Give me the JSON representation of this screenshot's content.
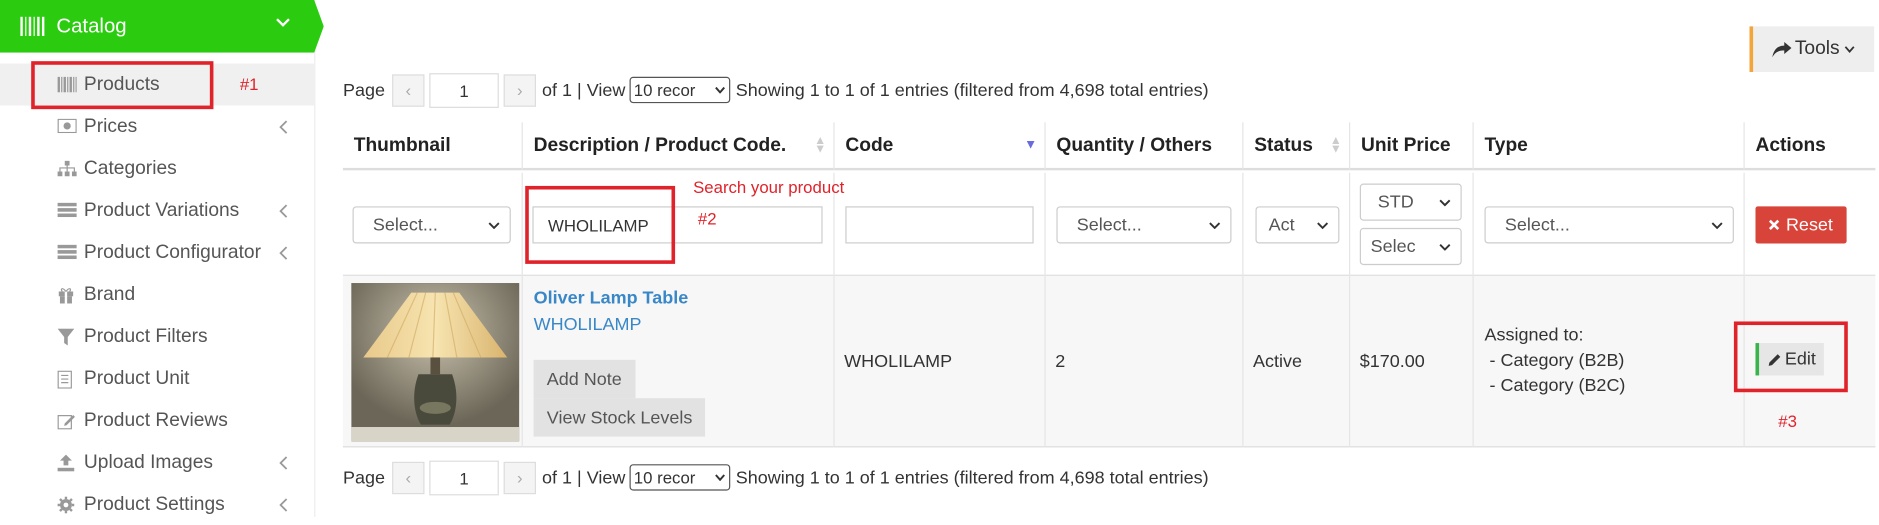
{
  "sidebar": {
    "header": {
      "title": "Catalog"
    },
    "items": [
      {
        "label": "Products",
        "icon": "barcode-icon",
        "has_submenu": false,
        "active": true
      },
      {
        "label": "Prices",
        "icon": "money-icon",
        "has_submenu": true
      },
      {
        "label": "Categories",
        "icon": "sitemap-icon",
        "has_submenu": false
      },
      {
        "label": "Product Variations",
        "icon": "list-icon",
        "has_submenu": true
      },
      {
        "label": "Product Configurator",
        "icon": "list-icon",
        "has_submenu": true
      },
      {
        "label": "Brand",
        "icon": "gift-icon",
        "has_submenu": false
      },
      {
        "label": "Product Filters",
        "icon": "filter-icon",
        "has_submenu": false
      },
      {
        "label": "Product Unit",
        "icon": "file-icon",
        "has_submenu": false
      },
      {
        "label": "Product Reviews",
        "icon": "edit-icon",
        "has_submenu": false
      },
      {
        "label": "Upload Images",
        "icon": "upload-icon",
        "has_submenu": true
      },
      {
        "label": "Product Settings",
        "icon": "gear-icon",
        "has_submenu": true
      }
    ]
  },
  "annotations": {
    "a1": "#1",
    "a2": "#2",
    "a3": "#3",
    "search_hint": "Search your product"
  },
  "toolbar": {
    "tools_label": "Tools"
  },
  "pager": {
    "page_label": "Page",
    "page_value": "1",
    "of_label": "of 1 | View",
    "view_value": "10 recor",
    "showing": "Showing 1 to 1 of 1 entries (filtered from 4,698 total entries)"
  },
  "table": {
    "headers": {
      "thumbnail": "Thumbnail",
      "description": "Description / Product Code.",
      "code": "Code",
      "quantity": "Quantity / Others",
      "status": "Status",
      "unit_price": "Unit Price",
      "type": "Type",
      "actions": "Actions"
    },
    "filters": {
      "thumbnail_select": "Select...",
      "description_value": "WHOLILAMP",
      "code_value": "",
      "quantity_select": "Select...",
      "status_select": "Act",
      "price_type_select": "STD",
      "price_select": "Selec",
      "type_select": "Select...",
      "reset_label": "Reset"
    },
    "row": {
      "name": "Oliver Lamp Table",
      "product_code": "WHOLILAMP",
      "add_note_label": "Add Note",
      "stock_label": "View Stock Levels",
      "code": "WHOLILAMP",
      "quantity": "2",
      "status": "Active",
      "unit_price": "$170.00",
      "type_line1": "Assigned to:",
      "type_line2": " - Category (B2B)",
      "type_line3": " - Category (B2C)",
      "edit_label": "Edit"
    }
  },
  "colors": {
    "catalog_green": "#2bcc10",
    "annotation_red": "#e0232b",
    "reset_red": "#d9443a",
    "link_blue": "#3a87c8",
    "tools_accent": "#f4a53a",
    "edit_accent": "#38b44a"
  }
}
